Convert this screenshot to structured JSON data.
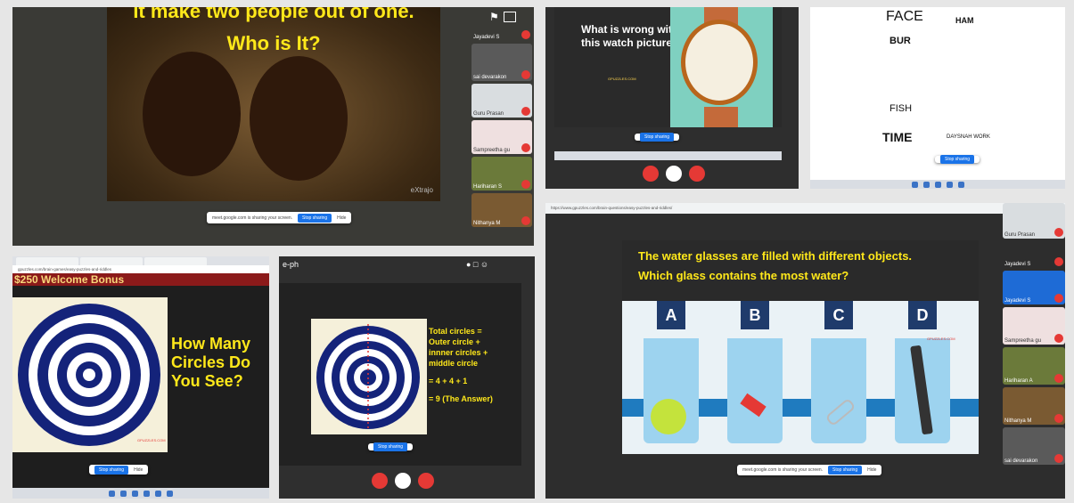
{
  "panel1": {
    "riddle_line1": "It make two people out of one.",
    "riddle_line2": "Who is It?",
    "watermark": "eXtrajo",
    "share_text": "meet.google.com is sharing your screen.",
    "stop_label": "Stop sharing",
    "hide_label": "Hide",
    "participants": [
      "Jayadevi S",
      "sai devarakon",
      "Guru Prasan",
      "Sampreetha gu",
      "Hariharan S",
      "Nithanya M"
    ]
  },
  "panel2": {
    "question": "What is wrong with this watch picture?",
    "watermark": "GPUZZLES.COM",
    "stop_label": "Stop sharing"
  },
  "panel3": {
    "cells": [
      "FACE",
      "HAM",
      "BUR",
      "TIME",
      "FISH",
      "DAYSNAH WORK"
    ],
    "stop_label": "Stop sharing"
  },
  "panel4": {
    "ad": "$250 Welcome Bonus",
    "url": "gpuzzles.com/brain-games/easy-puzzles-and-riddles",
    "question": "How Many Circles Do You See?",
    "watermark": "GPUZZLES.COM",
    "stop_label": "Stop sharing",
    "hide_label": "Hide"
  },
  "panel5": {
    "title": "e-ph",
    "answer_lines": [
      "Total circles =",
      "Outer circle +",
      "innner circles +",
      "middle circle",
      "= 4 + 4 + 1",
      "= 9 (The Answer)"
    ],
    "watermark": "GPUZZLES.COM",
    "stop_label": "Stop sharing"
  },
  "panel6": {
    "url": "https://www.gpuzzles.com/brain-questions/easy-puzzles-and-riddles/",
    "question_line1": "The water glasses are filled with different objects.",
    "question_line2": "Which glass contains the most water?",
    "glasses": [
      "A",
      "B",
      "C",
      "D"
    ],
    "watermark": "GPUZZLES.COM",
    "share_text": "meet.google.com is sharing your screen.",
    "stop_label": "Stop sharing",
    "hide_label": "Hide",
    "participants": [
      "Guru Prasan",
      "Jayadevi S",
      "Jayadevi S",
      "Sampreetha gu",
      "Hariharan A",
      "Nithanya M",
      "sai devarakon"
    ]
  },
  "colors": {
    "accent": "#ffe81a",
    "navy": "#14237a",
    "red": "#e53935",
    "blue": "#1a73e8"
  }
}
